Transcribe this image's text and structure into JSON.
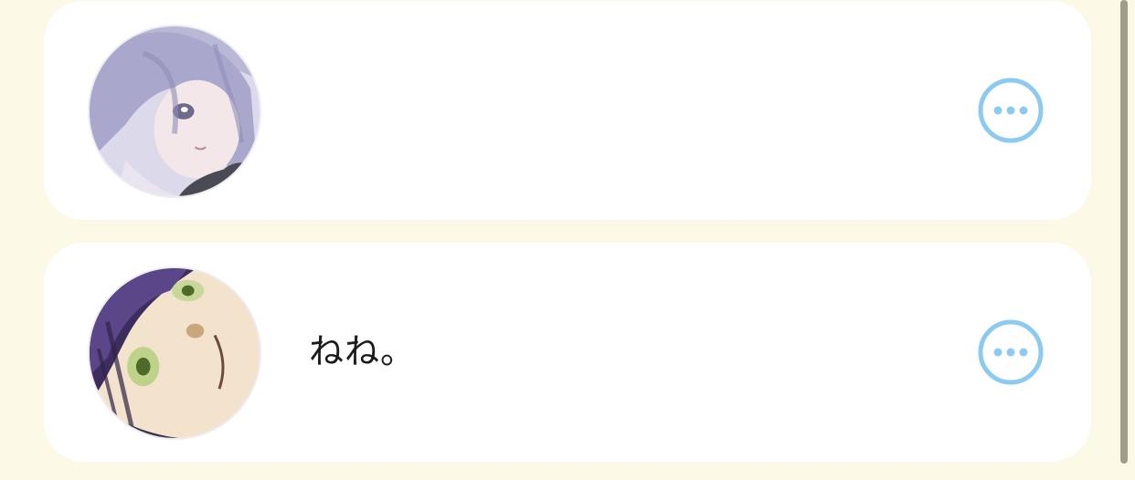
{
  "list": {
    "items": [
      {
        "avatar_icon": "anime-avatar-silver-hair",
        "text": "",
        "more_icon": "more-options-icon"
      },
      {
        "avatar_icon": "anime-avatar-purple-hair",
        "text": "ねね。",
        "more_icon": "more-options-icon"
      }
    ]
  },
  "colors": {
    "background": "#fcf9e7",
    "card": "#ffffff",
    "accent": "#8ccaef",
    "scrollbar": "#a09c8a"
  }
}
